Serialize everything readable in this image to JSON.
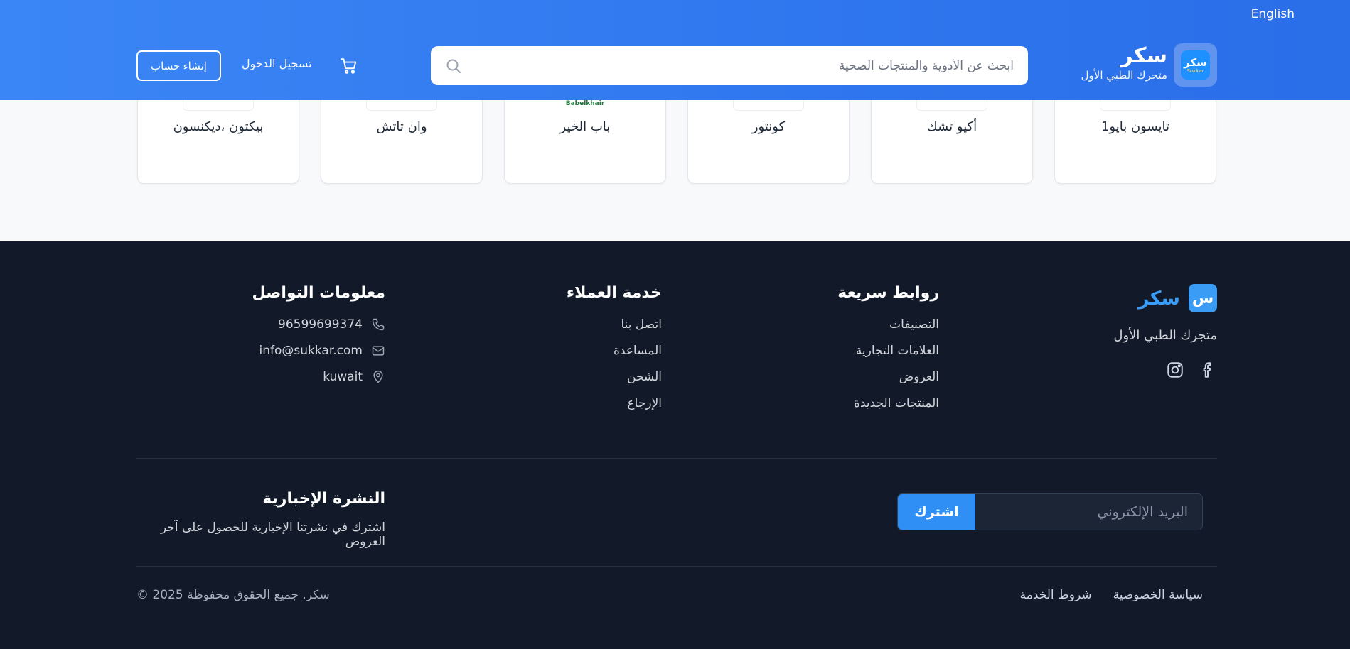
{
  "header": {
    "language_label": "English",
    "brand_name": "سكر",
    "brand_tagline": "متجرك الطبي الأول",
    "logo_text_ar": "سكر",
    "logo_text_en": "Sukkar",
    "search_placeholder": "ابحث عن الأدوية والمنتجات الصحية",
    "login_label": "تسجيل الدخول",
    "signup_label": "إنشاء حساب"
  },
  "brand_cards": [
    {
      "name": "تايسون بايو1"
    },
    {
      "name": "أكيو تشك"
    },
    {
      "name": "كونتور"
    },
    {
      "name": "باب الخير",
      "logo_text": "Babelkhair"
    },
    {
      "name": "وان تاتش"
    },
    {
      "name": "بيكتون ،ديكنسون"
    }
  ],
  "footer": {
    "logo_letter": "س",
    "brand_name": "سكر",
    "tagline": "متجرك الطبي الأول",
    "quick_links": {
      "title": "روابط سريعة",
      "items": [
        "التصنيفات",
        "العلامات التجارية",
        "العروض",
        "المنتجات الجديدة"
      ]
    },
    "customer_service": {
      "title": "خدمة العملاء",
      "items": [
        "اتصل بنا",
        "المساعدة",
        "الشحن",
        "الإرجاع"
      ]
    },
    "contact": {
      "title": "معلومات التواصل",
      "phone": "96599699374",
      "email": "info@sukkar.com",
      "location": "kuwait"
    },
    "newsletter": {
      "title": "النشرة الإخبارية",
      "subtitle": "اشترك في نشرتنا الإخبارية للحصول على آخر العروض",
      "email_placeholder": "البريد الإلكتروني",
      "subscribe_label": "اشترك"
    },
    "bottom": {
      "privacy_label": "سياسة الخصوصية",
      "terms_label": "شروط الخدمة",
      "copyright": "© 2025 سكر. جميع الحقوق محفوظة"
    }
  },
  "colors": {
    "header_gradient_start": "#3b86f6",
    "header_gradient_end": "#2a6ee8",
    "footer_bg": "#121a29",
    "accent_blue": "#2f8ff5"
  }
}
